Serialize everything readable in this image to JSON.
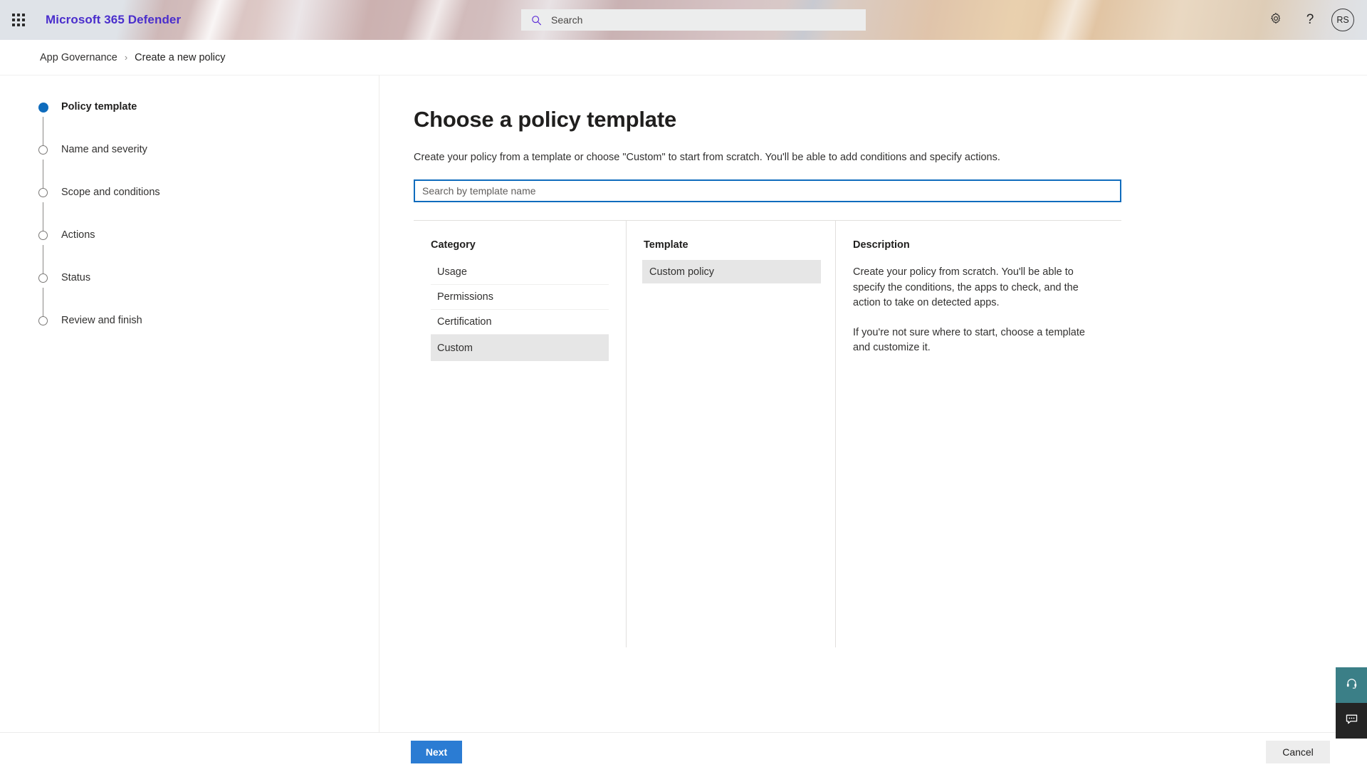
{
  "header": {
    "app_launcher_icon": "waffle-grid-icon",
    "brand": "Microsoft 365 Defender",
    "search": {
      "icon": "search-icon",
      "placeholder": "Search",
      "value": ""
    },
    "settings_icon": "gear-icon",
    "help_icon": "question-mark-icon",
    "account_initials": "RS"
  },
  "breadcrumb": {
    "parent": "App Governance",
    "separator": "›",
    "current": "Create a new policy"
  },
  "wizard_steps": [
    {
      "label": "Policy template",
      "state": "active"
    },
    {
      "label": "Name and severity",
      "state": "pending"
    },
    {
      "label": "Scope and conditions",
      "state": "pending"
    },
    {
      "label": "Actions",
      "state": "pending"
    },
    {
      "label": "Status",
      "state": "pending"
    },
    {
      "label": "Review and finish",
      "state": "pending"
    }
  ],
  "main": {
    "title": "Choose a policy template",
    "subtitle": "Create your policy from a template or choose \"Custom\" to start from scratch. You'll be able to add conditions and specify actions.",
    "template_search": {
      "placeholder": "Search by template name",
      "value": ""
    },
    "category": {
      "heading": "Category",
      "items": [
        {
          "label": "Usage",
          "selected": false
        },
        {
          "label": "Permissions",
          "selected": false
        },
        {
          "label": "Certification",
          "selected": false
        },
        {
          "label": "Custom",
          "selected": true
        }
      ]
    },
    "template": {
      "heading": "Template",
      "items": [
        {
          "label": "Custom policy",
          "selected": true
        }
      ]
    },
    "description": {
      "heading": "Description",
      "paragraphs": [
        "Create your policy from scratch. You'll be able to specify the conditions, the apps to check, and the action to take on detected apps.",
        "If you're not sure where to start, choose a template and customize it."
      ]
    }
  },
  "footer": {
    "next_label": "Next",
    "cancel_label": "Cancel"
  },
  "float_buttons": [
    {
      "name": "support-icon",
      "tone": "#3b7f87"
    },
    {
      "name": "feedback-icon",
      "tone": "#242424"
    }
  ],
  "colors": {
    "accent_blue": "#0f6cbd",
    "button_blue": "#2b7cd3",
    "brand_purple": "#4a2ecc",
    "selected_gray": "#e6e6e6",
    "support_teal": "#3b7f87",
    "feedback_dark": "#242424"
  }
}
